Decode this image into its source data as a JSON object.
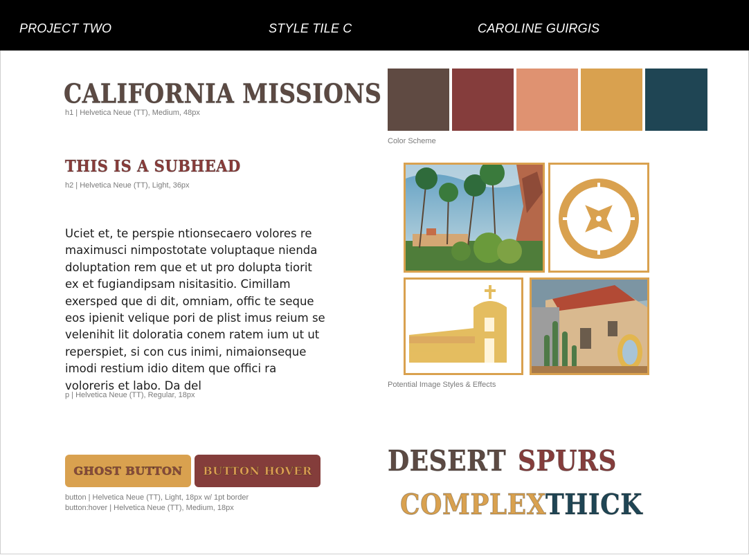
{
  "header": {
    "project": "PROJECT TWO",
    "tile": "STYLE TILE C",
    "author": "CAROLINE GUIRGIS"
  },
  "typography": {
    "h1_text": "CALIFORNIA MISSIONS",
    "h1_spec": "h1 | Helvetica Neue (TT), Medium, 48px",
    "h2_text": "THIS IS A SUBHEAD",
    "h2_spec": "h2 | Helvetica Neue (TT), Light, 36px",
    "paragraph": "Uciet et, te perspie ntionsecaero volores re maximusci nimpostotate voluptaque nienda doluptation rem que et ut pro dolupta tiorit ex et fugiandipsam nisitasitio. Cimillam exersped que di dit, omniam, offic te seque eos ipienit velique pori de plist imus reium se velenihit lit doloratia conem ratem ium ut ut reperspiet, si con cus inimi, nimaionseque imodi restium idio ditem que offici ra voloreris et labo. Da del",
    "p_spec": "p | Helvetica Neue (TT), Regular, 18px"
  },
  "buttons": {
    "ghost_label": "GHOST BUTTON",
    "hover_label": "BUTTON HOVER",
    "spec_line1": "button | Helvetica Neue (TT), Light, 18px w/ 1pt border",
    "spec_line2": "button:hover | Helvetica Neue (TT), Medium, 18px"
  },
  "color_scheme": {
    "label": "Color Scheme",
    "swatches": [
      "#5f4a42",
      "#853d3c",
      "#df9271",
      "#d9a14f",
      "#1f4554"
    ]
  },
  "images": {
    "label": "Potential Image Styles & Effects",
    "items": [
      "mission-painting-palms",
      "compass-icon",
      "mission-church-icon",
      "mission-painting-cactus"
    ]
  },
  "display_words": {
    "word1": "DESERT",
    "word2": "SPURS",
    "word3": "COMPLEX",
    "word4": "THICK",
    "colors": [
      "#5c4a43",
      "#853d3c",
      "#d9a14f",
      "#1f4554"
    ]
  }
}
